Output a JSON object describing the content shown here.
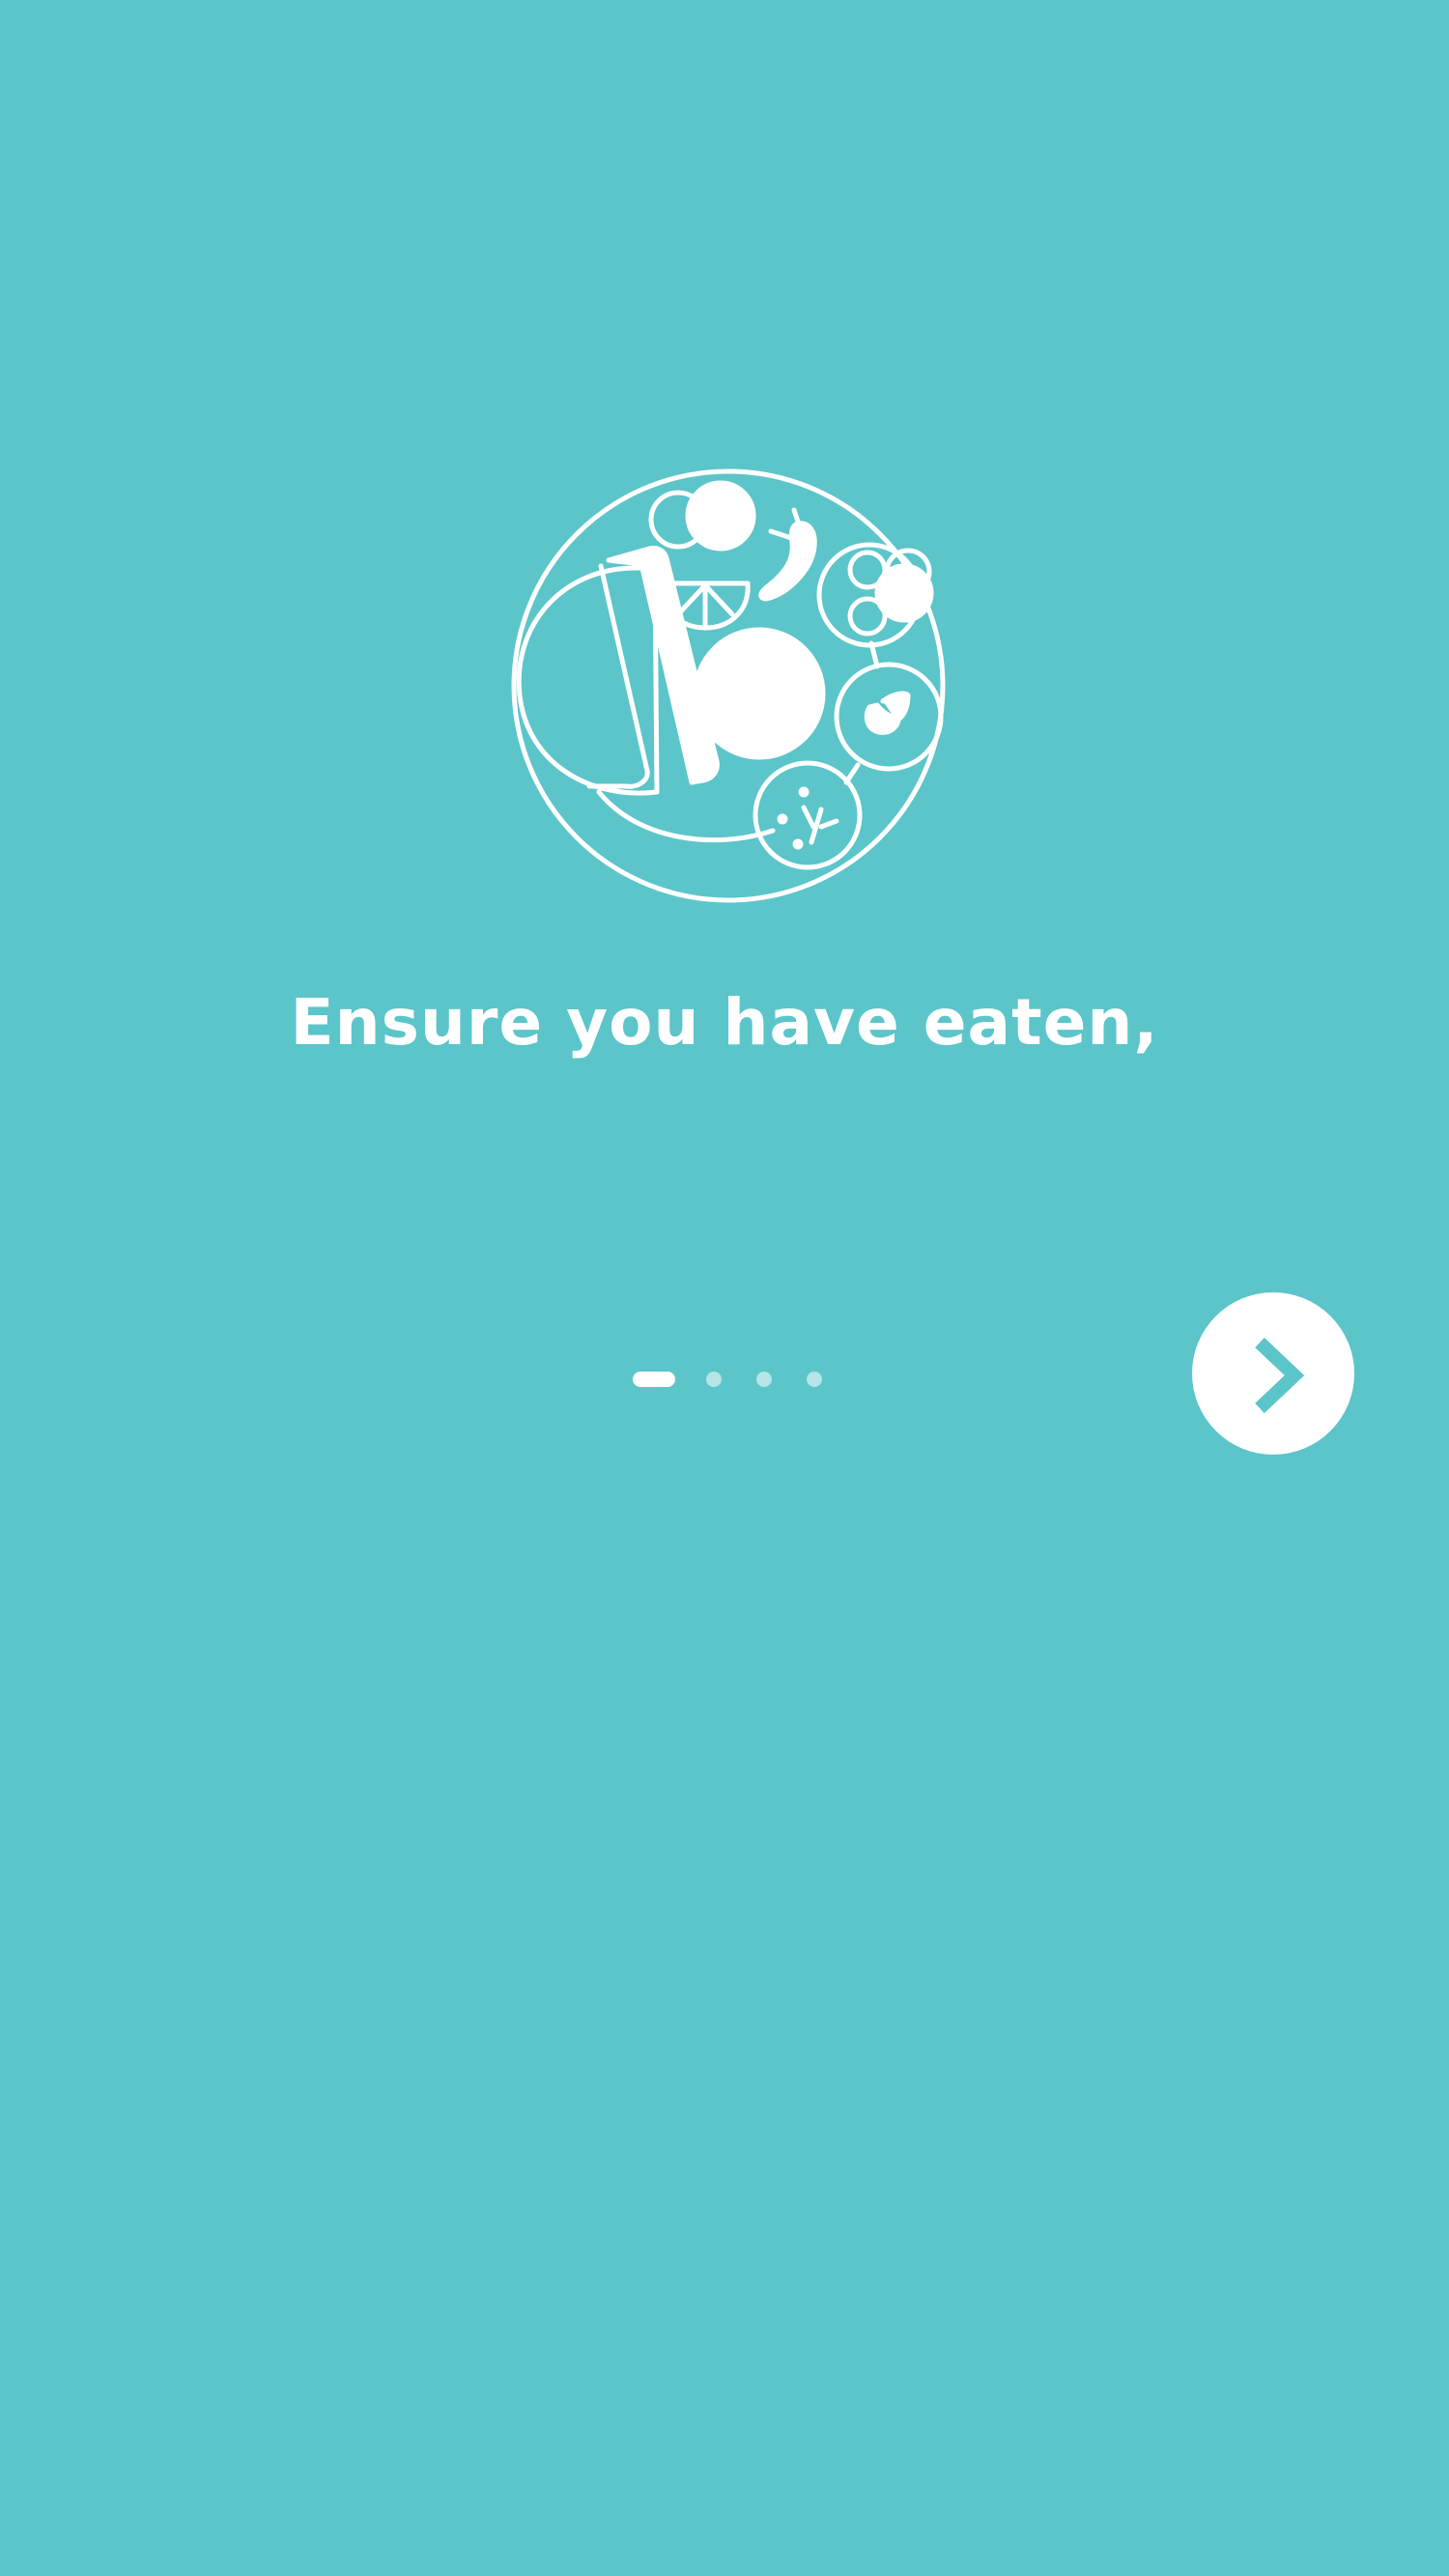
{
  "screen": {
    "background_color": "#5bc5ca"
  },
  "onboarding": {
    "illustration_icon": "food-plate-icon",
    "headline": "Ensure you have eaten,",
    "pager": {
      "total_pages": 4,
      "current_page": 1
    },
    "next_button": {
      "icon": "chevron-right-icon",
      "accent_color": "#5bc5ca"
    }
  }
}
